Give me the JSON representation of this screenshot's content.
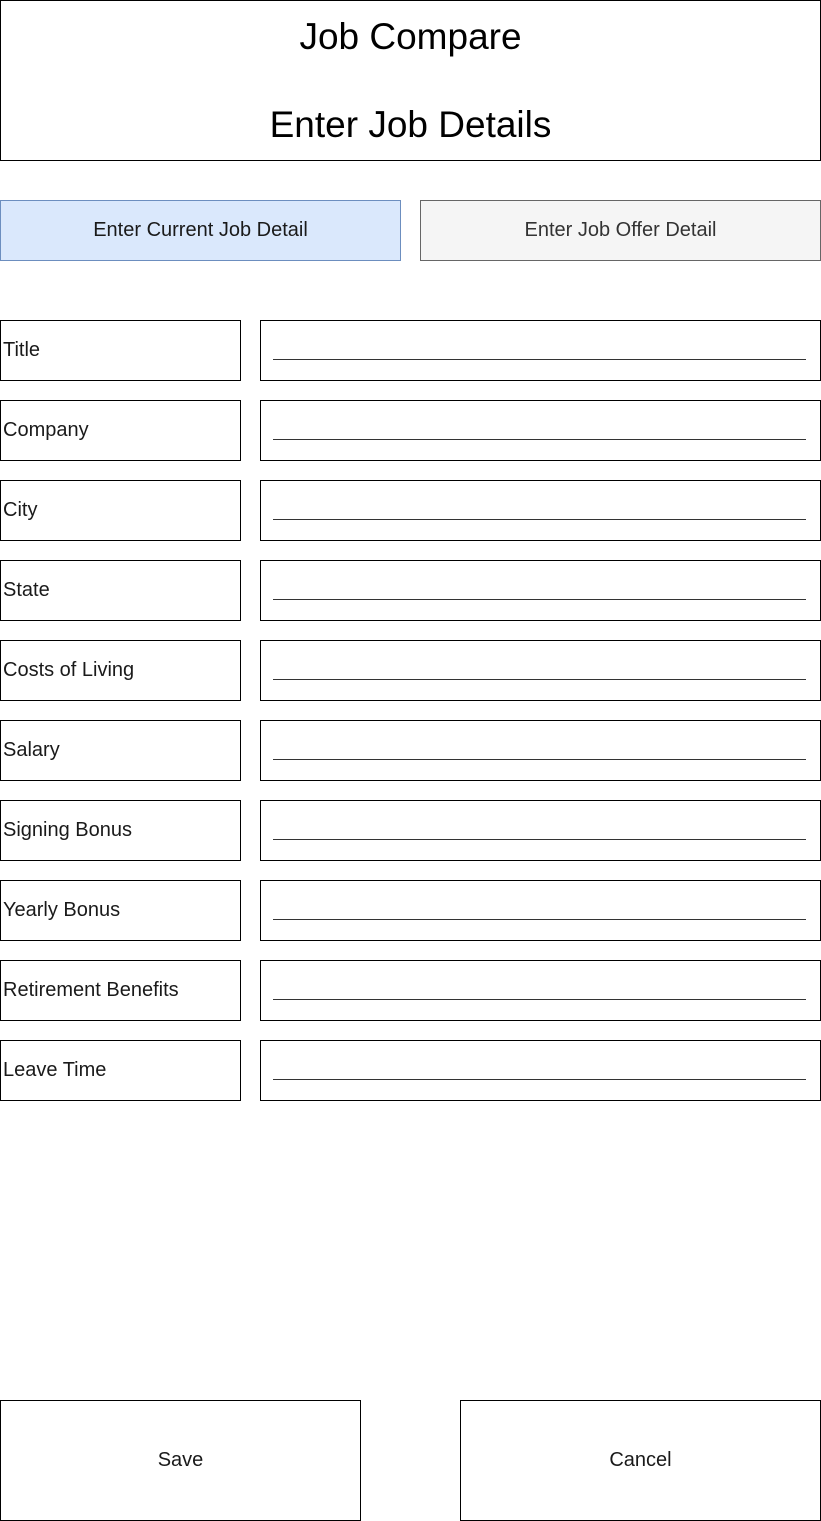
{
  "header": {
    "app_title": "Job Compare",
    "page_title": "Enter Job Details"
  },
  "tabs": [
    {
      "label": "Enter Current Job Detail",
      "active": true
    },
    {
      "label": "Enter Job Offer Detail",
      "active": false
    }
  ],
  "form": {
    "fields": [
      {
        "label": "Title",
        "value": ""
      },
      {
        "label": "Company",
        "value": ""
      },
      {
        "label": "City",
        "value": ""
      },
      {
        "label": "State",
        "value": ""
      },
      {
        "label": "Costs of Living",
        "value": ""
      },
      {
        "label": "Salary",
        "value": ""
      },
      {
        "label": "Signing Bonus",
        "value": ""
      },
      {
        "label": "Yearly Bonus",
        "value": ""
      },
      {
        "label": "Retirement Benefits",
        "value": ""
      },
      {
        "label": "Leave Time",
        "value": ""
      }
    ]
  },
  "actions": {
    "save_label": "Save",
    "cancel_label": "Cancel"
  },
  "colors": {
    "active_tab_fill": "#dae8fc",
    "active_tab_border": "#6c8ebf",
    "inactive_tab_fill": "#f5f5f5",
    "inactive_tab_border": "#666666"
  }
}
